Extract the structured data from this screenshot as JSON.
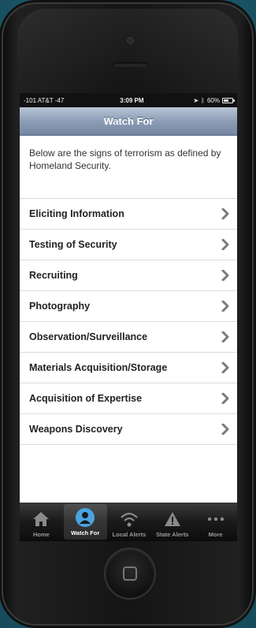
{
  "status_bar": {
    "carrier": "-101 AT&T -47",
    "time": "3:09 PM",
    "battery": "60%",
    "battery_level": 0.6
  },
  "nav": {
    "title": "Watch For"
  },
  "intro": {
    "text": "Below are the signs of terrorism as defined by Homeland Security."
  },
  "items": [
    {
      "label": "Eliciting Information"
    },
    {
      "label": "Testing of Security"
    },
    {
      "label": "Recruiting"
    },
    {
      "label": "Photography"
    },
    {
      "label": "Observation/Surveillance"
    },
    {
      "label": "Materials Acquisition/Storage"
    },
    {
      "label": "Acquisition of Expertise"
    },
    {
      "label": "Weapons Discovery"
    }
  ],
  "tabs": [
    {
      "label": "Home",
      "icon": "house-icon"
    },
    {
      "label": "Watch For",
      "icon": "eye-icon",
      "active": true
    },
    {
      "label": "Local Alerts",
      "icon": "broadcast-icon"
    },
    {
      "label": "State Alerts",
      "icon": "warning-icon"
    },
    {
      "label": "More",
      "icon": "more-dots-icon"
    }
  ],
  "colors": {
    "active_icon": "#4aa3e0",
    "chevron": "#7a7a7a",
    "nav_bar": "#8d9db6"
  }
}
